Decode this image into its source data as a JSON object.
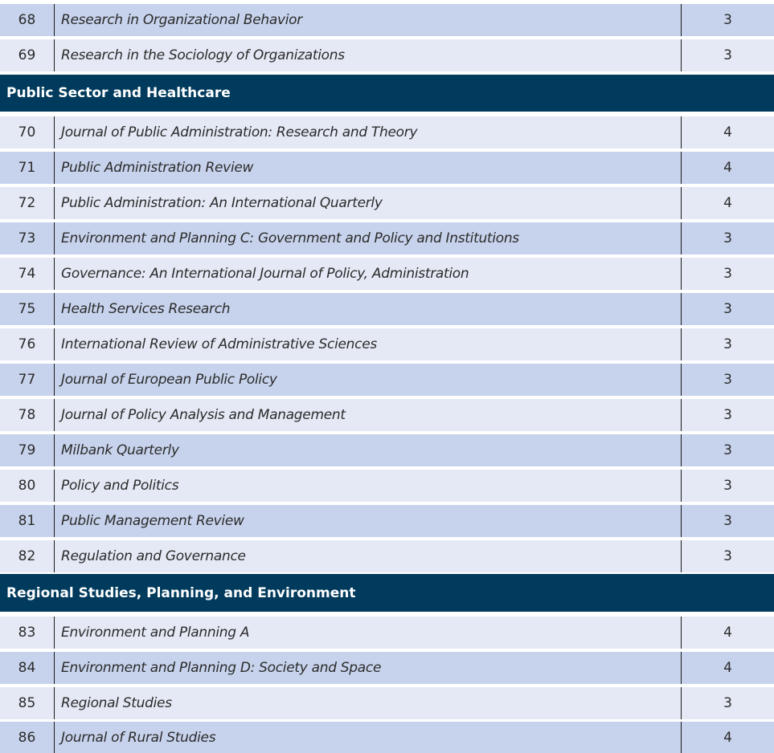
{
  "groups": [
    {
      "rows": [
        {
          "num": "68",
          "title": "Research in Organizational Behavior",
          "rank": "3"
        },
        {
          "num": "69",
          "title": "Research in the Sociology of Organizations",
          "rank": "3"
        }
      ]
    },
    {
      "section": "Public Sector and Healthcare",
      "rows": [
        {
          "num": "70",
          "title": "Journal of Public Administration: Research and Theory",
          "rank": "4"
        },
        {
          "num": "71",
          "title": "Public Administration Review",
          "rank": "4"
        },
        {
          "num": "72",
          "title": "Public Administration: An International Quarterly",
          "rank": "4"
        },
        {
          "num": "73",
          "title": "Environment and Planning C: Government and Policy and Institutions",
          "rank": "3"
        },
        {
          "num": "74",
          "title": "Governance: An International Journal of Policy, Administration",
          "rank": "3"
        },
        {
          "num": "75",
          "title": "Health Services Research",
          "rank": "3"
        },
        {
          "num": "76",
          "title": "International Review of Administrative Sciences",
          "rank": "3"
        },
        {
          "num": "77",
          "title": "Journal of European Public Policy",
          "rank": "3"
        },
        {
          "num": "78",
          "title": "Journal of Policy Analysis and Management",
          "rank": "3"
        },
        {
          "num": "79",
          "title": "Milbank Quarterly",
          "rank": "3"
        },
        {
          "num": "80",
          "title": "Policy and Politics",
          "rank": "3"
        },
        {
          "num": "81",
          "title": "Public Management Review",
          "rank": "3"
        },
        {
          "num": "82",
          "title": "Regulation and Governance",
          "rank": "3"
        }
      ]
    },
    {
      "section": "Regional Studies, Planning, and Environment",
      "rows": [
        {
          "num": "83",
          "title": "Environment and Planning A",
          "rank": "4"
        },
        {
          "num": "84",
          "title": "Environment and Planning D: Society and Space",
          "rank": "4"
        },
        {
          "num": "85",
          "title": "Regional Studies",
          "rank": "3"
        },
        {
          "num": "86",
          "title": "Journal of Rural Studies",
          "rank": "4"
        }
      ]
    }
  ],
  "colors": {
    "row_dark": "#c7d3ec",
    "row_light": "#e4e9f5",
    "section_bg": "#003a5c",
    "section_text": "#ffffff"
  }
}
